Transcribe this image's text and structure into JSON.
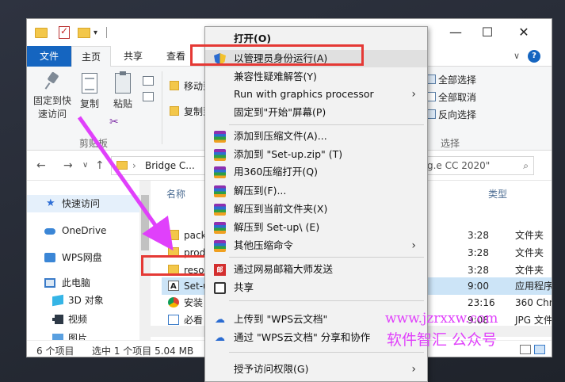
{
  "quick_access_toolbar": {
    "dropdown_glyph": "▾"
  },
  "window_controls": {
    "minimize": "—",
    "maximize": "☐",
    "close": "✕"
  },
  "ribbon_tabs": {
    "file": "文件",
    "home": "主页",
    "share": "共享",
    "view": "查看"
  },
  "ribbon_controls": {
    "collapse": "∨",
    "help": "?"
  },
  "ribbon": {
    "pin_quick_access": "固定到快",
    "pin_quick_access_2": "速访问",
    "copy": "复制",
    "paste": "粘贴",
    "clipboard_group": "剪贴板",
    "move_to": "移动到",
    "copy_to": "复制到",
    "select_all": "全部选择",
    "select_none": "全部取消",
    "invert_selection": "反向选择",
    "select_group": "选择"
  },
  "address_bar": {
    "back": "←",
    "forward": "→",
    "recent": "∨",
    "up": "↑",
    "breadcrumb_sep": "›",
    "path": "Bridge C...",
    "search_text": "g.e CC 2020\"",
    "search_glyph": "⌕"
  },
  "nav_pane": {
    "items": [
      {
        "label": "快速访问",
        "icon": "star-icon",
        "active": true
      },
      {
        "label": "OneDrive",
        "icon": "cloud-icon"
      },
      {
        "label": "WPS网盘",
        "icon": "wps-cloud-icon"
      },
      {
        "label": "此电脑",
        "icon": "computer-icon"
      },
      {
        "label": "3D 对象",
        "icon": "cube-icon"
      },
      {
        "label": "视频",
        "icon": "video-icon"
      },
      {
        "label": "图片",
        "icon": "picture-icon"
      }
    ]
  },
  "file_list": {
    "columns": {
      "name": "名称",
      "type": "类型"
    },
    "rows": [
      {
        "name": "pack",
        "time": "3:28",
        "type": "文件夹",
        "icon": "folder-icon"
      },
      {
        "name": "prod",
        "time": "3:28",
        "type": "文件夹",
        "icon": "folder-icon"
      },
      {
        "name": "reso",
        "time": "3:28",
        "type": "文件夹",
        "icon": "folder-icon"
      },
      {
        "name": "Set-u",
        "time": "9:00",
        "type": "应用程序",
        "icon": "app-icon",
        "selected": true
      },
      {
        "name": "安装",
        "time": "23:16",
        "type": "360 Chrome",
        "icon": "chrome-icon"
      },
      {
        "name": "必看",
        "time": "9:08",
        "type": "JPG 文件",
        "icon": "jpg-icon"
      }
    ]
  },
  "status_bar": {
    "item_count": "6 个项目",
    "selection": "选中 1 个项目  5.04 MB"
  },
  "context_menu": {
    "items": [
      {
        "label": "打开(O)",
        "bold": true
      },
      {
        "label": "以管理员身份运行(A)",
        "icon": "shield-icon",
        "hover": true
      },
      {
        "label": "兼容性疑难解答(Y)"
      },
      {
        "label": "Run with graphics processor",
        "submenu": true
      },
      {
        "label": "固定到\"开始\"屏幕(P)"
      },
      {
        "label": "添加到压缩文件(A)...",
        "icon": "archive-icon"
      },
      {
        "label": "添加到 \"Set-up.zip\" (T)",
        "icon": "archive-icon"
      },
      {
        "label": "用360压缩打开(Q)",
        "icon": "archive-icon"
      },
      {
        "label": "解压到(F)...",
        "icon": "archive-icon"
      },
      {
        "label": "解压到当前文件夹(X)",
        "icon": "archive-icon"
      },
      {
        "label": "解压到 Set-up\\ (E)",
        "icon": "archive-icon"
      },
      {
        "label": "其他压缩命令",
        "icon": "archive-icon",
        "submenu": true
      },
      {
        "label": "通过网易邮箱大师发送",
        "icon": "mail-163-icon"
      },
      {
        "label": "共享",
        "icon": "share-icon"
      },
      {
        "label": "上传到 \"WPS云文档\"",
        "icon": "cloud-upload-icon"
      },
      {
        "label": "通过 \"WPS云文档\" 分享和协作",
        "icon": "cloud-share-icon"
      },
      {
        "label": "授予访问权限(G)",
        "submenu": true
      }
    ],
    "submenu_glyph": "›",
    "mail_icon_text": "邮"
  },
  "watermark": {
    "line1": "www.jzrxxw.com",
    "line2": "软件智汇 公众号"
  },
  "colors": {
    "accent": "#1565c0",
    "highlight": "#e53935",
    "annotation": "#e040fb"
  }
}
